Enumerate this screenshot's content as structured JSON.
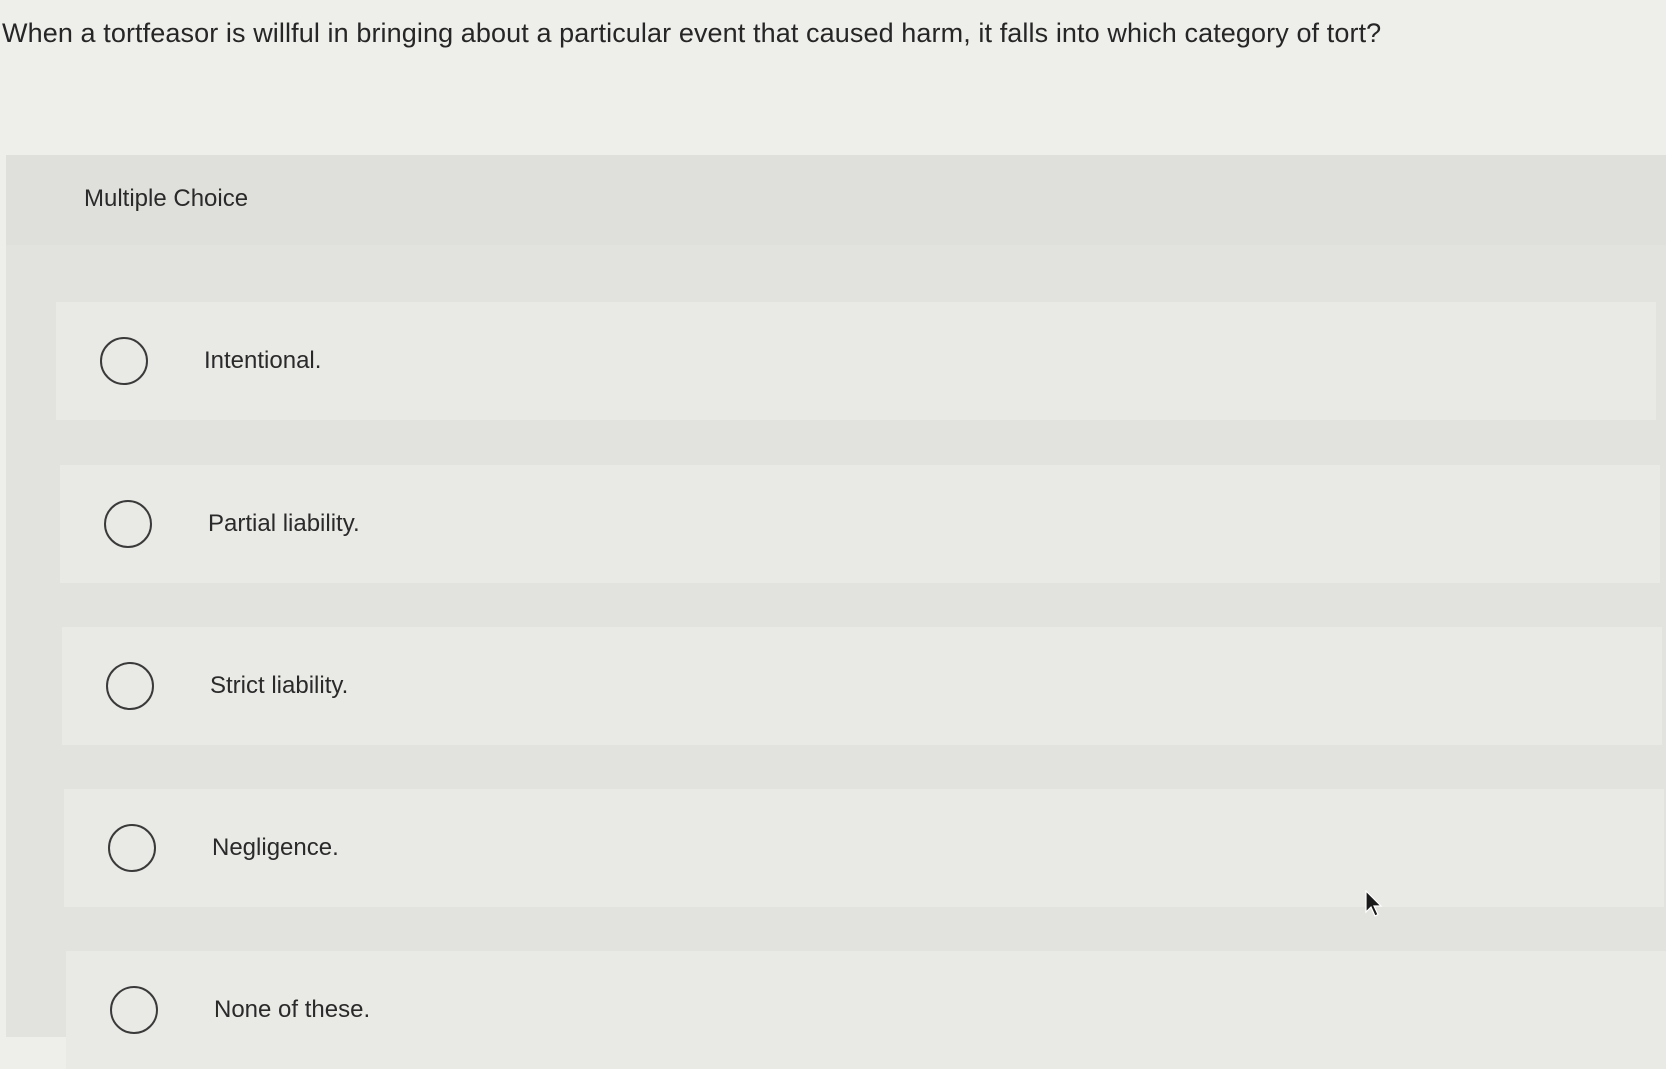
{
  "question": {
    "text": "When a tortfeasor is willful in bringing about a particular event that caused harm, it falls into which category of tort?"
  },
  "panel": {
    "label": "Multiple Choice"
  },
  "options": [
    {
      "label": "Intentional."
    },
    {
      "label": "Partial liability."
    },
    {
      "label": "Strict liability."
    },
    {
      "label": "Negligence."
    },
    {
      "label": "None of these."
    }
  ],
  "icons": {
    "radio": "radio-unchecked-icon",
    "cursor": "mouse-pointer-icon"
  }
}
